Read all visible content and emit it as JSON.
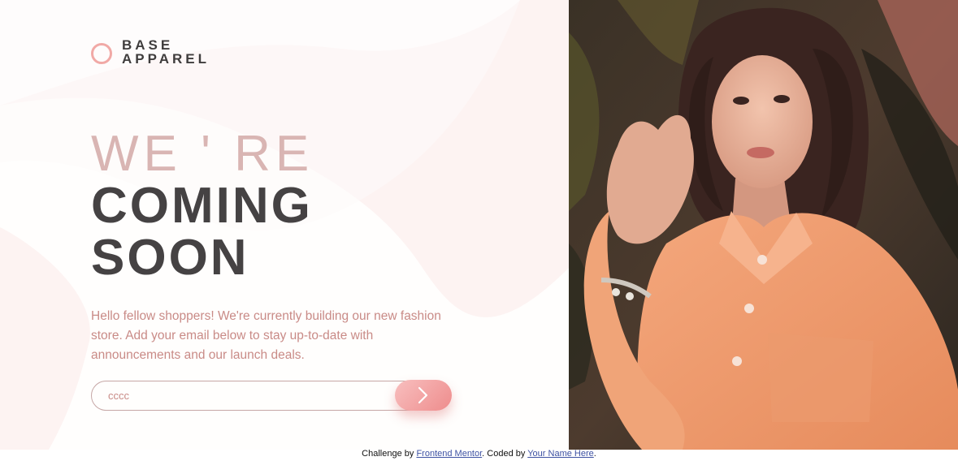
{
  "brand": {
    "line1": "BASE",
    "line2": "APPAREL",
    "accent_color": "#f1a9a6",
    "icon": "ring-logo-icon"
  },
  "hero": {
    "headline_light": "WE ' RE",
    "headline_dark_1": "COMING",
    "headline_dark_2": "SOON",
    "description": "Hello fellow shoppers! We're currently building our new fashion store. Add your email below to stay up-to-date with announcements and our launch deals."
  },
  "form": {
    "email_value": "cccc",
    "submit_icon": "chevron-right-icon"
  },
  "photo": {
    "icon": "model-photo"
  },
  "footer": {
    "prefix": "Challenge by ",
    "link1": "Frontend Mentor",
    "middle": ". Coded by ",
    "link2": "Your Name Here",
    "suffix": "."
  },
  "colors": {
    "headline_light": "#d9b5b3",
    "headline_dark": "#454243",
    "body_text": "#c98b87",
    "button_gradient_start": "#f8bfbf",
    "button_gradient_end": "#ee8c8c",
    "link": "#3e52a3"
  }
}
